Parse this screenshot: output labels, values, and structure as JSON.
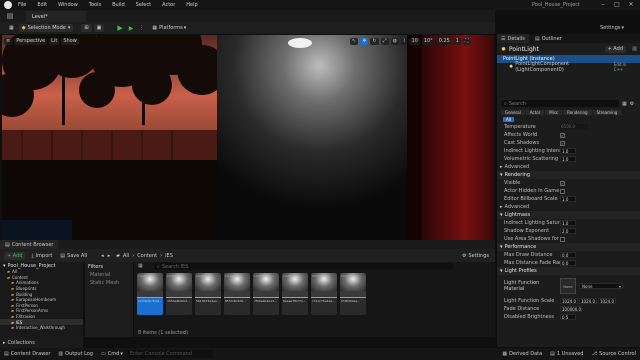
{
  "menu": {
    "items": [
      "File",
      "Edit",
      "Window",
      "Tools",
      "Build",
      "Select",
      "Actor",
      "Help"
    ],
    "project_name": "Pool_House_Project"
  },
  "level_tab": "Level*",
  "toolbar": {
    "mode_label": "Selection Mode",
    "platforms_label": "Platforms",
    "settings_label": "Settings"
  },
  "viewport": {
    "perspective_label": "Perspective",
    "lit_label": "Lit",
    "show_label": "Show",
    "grid_value": "10",
    "rot_value": "10°",
    "scale_value": "0.25",
    "cam_value": "1"
  },
  "details": {
    "tab_details": "Details",
    "tab_outliner": "Outliner",
    "actor_name": "PointLight",
    "add_label": "+ Add",
    "instance_label": "PointLight (Instance)",
    "component_label": "PointLightComponent (LightComponent0)",
    "edit_cpp": "Edit in C++",
    "search_placeholder": "Search",
    "filters": [
      "General",
      "Actor",
      "Misc",
      "Rendering",
      "Streaming"
    ],
    "filter_all": "All",
    "props_top": [
      {
        "label": "Temperature",
        "value": "6500.0",
        "kind": "grey"
      },
      {
        "label": "Affects World",
        "kind": "check"
      },
      {
        "label": "Cast Shadows",
        "kind": "check"
      },
      {
        "label": "Indirect Lighting Intensity",
        "value": "1.0",
        "kind": "num"
      },
      {
        "label": "Volumetric Scattering Inte...",
        "value": "1.0",
        "kind": "num"
      }
    ],
    "section_advanced": "Advanced",
    "section_rendering": "Rendering",
    "props_rendering": [
      {
        "label": "Visible",
        "kind": "check"
      },
      {
        "label": "Actor Hidden In Game",
        "kind": "box"
      },
      {
        "label": "Editor Billboard Scale",
        "value": "1.0",
        "kind": "num"
      }
    ],
    "section_advanced2": "Advanced",
    "section_lightmass": "Lightmass",
    "props_lightmass": [
      {
        "label": "Indirect Lighting Saturation",
        "value": "1.0",
        "kind": "num"
      },
      {
        "label": "Shadow Exponent",
        "value": "2.0",
        "kind": "num"
      },
      {
        "label": "Use Area Shadows for Sta...",
        "kind": "box"
      }
    ],
    "section_performance": "Performance",
    "props_performance": [
      {
        "label": "Max Draw Distance",
        "value": "0.0",
        "kind": "num"
      },
      {
        "label": "Max Distance Fade Range",
        "value": "0.0",
        "kind": "num"
      }
    ],
    "section_light_profiles": "Light Profiles",
    "ies_label": "Light Function Material",
    "ies_none": "None",
    "props_profiles": [
      {
        "label": "Light Function Scale",
        "value": "1024.0",
        "value2": "1024.0",
        "value3": "1024.0"
      },
      {
        "label": "Fade Distance",
        "value": "100000.0"
      },
      {
        "label": "Disabled Brightness",
        "value": "0.5"
      }
    ]
  },
  "content_browser": {
    "tab_label": "Content Browser",
    "add_label": "+ Add",
    "import_label": "Import",
    "save_all_label": "Save All",
    "breadcrumb": [
      "All",
      "Content",
      "IES"
    ],
    "settings_label": "Settings",
    "tree_root": "Pool_House_Project",
    "tree_items": [
      "All",
      "Content",
      "Animations",
      "Blueprints",
      "Building",
      "EuropeanHornbeam",
      "FirstPerson",
      "FirstPersonArms",
      "FXtrasion",
      "IES",
      "Interactive_Walkthrough"
    ],
    "filters_label": "Filters",
    "filter_items": [
      "Material",
      "Static Mesh"
    ],
    "search_placeholder": "Search IES",
    "item_count": "8 items (1 selected)",
    "collections_label": "Collections",
    "assets": [
      {
        "type": "LIGHT",
        "name": "100dsdb7fcb4..."
      },
      {
        "type": "LIGHT",
        "name": "3954a8b0fed..."
      },
      {
        "type": "LIGHT",
        "name": "5613b75a4ee..."
      },
      {
        "type": "LIGHT",
        "name": "6f7dc4b529..."
      },
      {
        "type": "LIGHT",
        "name": "7f00e4b4a13..."
      },
      {
        "type": "LIGHT",
        "name": "8aeaa7fb771..."
      },
      {
        "type": "LIGHT",
        "name": "c72dc75a4ee..."
      },
      {
        "type": "LIGHT",
        "name": "f2d8d90ea..."
      }
    ]
  },
  "statusbar": {
    "content_drawer": "Content Drawer",
    "output_log": "Output Log",
    "cmd": "Cmd",
    "cmd_placeholder": "Enter Console Command",
    "derived_data": "Derived Data",
    "unsaved": "1 Unsaved",
    "source_control": "Source Control"
  },
  "colors": {
    "accent_blue": "#1a6fd1",
    "accent_green": "#35c24b",
    "selected_row": "#1b4f8a"
  }
}
